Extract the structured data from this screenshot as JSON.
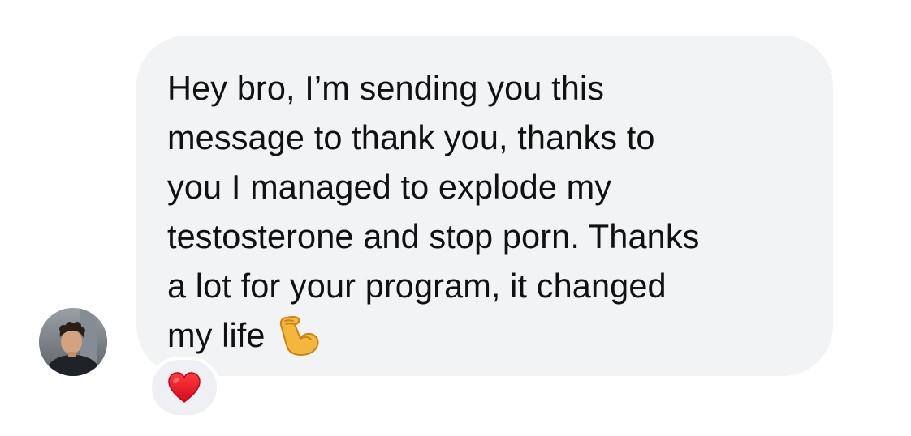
{
  "message": {
    "lines": [
      "Hey bro, I’m sending you this",
      "message to thank you, thanks to",
      "you I managed to explode my",
      "testosterone and stop porn. Thanks",
      "a lot for your program, it changed",
      "my life"
    ],
    "trailing_emoji": "flexed-biceps-icon",
    "bubble_color": "#f2f3f5",
    "text_color": "#111111"
  },
  "sender": {
    "avatar": "profile-photo-icon"
  },
  "reaction": {
    "emoji": "red-heart-icon",
    "heart_color": "#e8102a"
  }
}
